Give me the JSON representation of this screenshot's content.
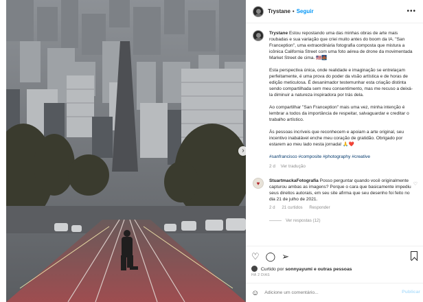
{
  "post": {
    "username": "Trystane",
    "dot": "•",
    "follow_label": "Seguir",
    "more_icon": "more-horizontal-icon"
  },
  "caption": {
    "username": "Trystane",
    "p1": "Estou repostando uma das minhas obras de arte mais roubadas e sua variação que criei muito antes do boom da IA. \"San Franception\", uma extraordinária fotografia composta que mistura a icônica California Street com uma foto aérea de drone da movimentada Market Street de cima. 🇺🇸🌉",
    "p2": "Esta perspectiva única, onde realidade e imaginação se entrelaçam perfeitamente, é uma prova do poder da visão artística e de horas de edição meticulosa. É desanimador testemunhar esta criação distinta sendo compartilhada sem meu consentimento, mas me recuso a deixá-la diminuir a natureza inspiradora por trás dela.",
    "p3": "Ao compartilhar \"San Franception\" mais uma vez, minha intenção é lembrar a todos da importância de respeitar, salvaguardar e creditar o trabalho artístico.",
    "p4": "Às pessoas incríveis que reconhecem e apoiam a arte original, seu incentivo inabalável enche meu coração de gratidão. Obrigado por estarem ao meu lado nesta jornada! 🙏❤️",
    "tags": "#sanfrancisco #composite #photography #creative",
    "age": "2 d",
    "translate": "Ver tradução"
  },
  "comment": {
    "username": "StuartmackaFotografia",
    "text": "Posso perguntar quando você originalmente capturou ambas as imagens? Porque o cara que basicamente impediu seus direitos autorais, em seu site afirma que seu desenho foi feito no dia 21 de julho de 2021.",
    "age": "2 d",
    "likes": "21 curtidos",
    "reply": "Responder",
    "view_replies": "Ver respostas (12)"
  },
  "actions": {
    "liked_prefix": "Curtido por",
    "liked_user": "sonnyayumi",
    "liked_suffix": "e outras pessoas",
    "date": "HÁ 2 DIAS"
  },
  "comment_box": {
    "placeholder": "Adicione um comentário...",
    "publish": "Publicar"
  },
  "colors": {
    "accent": "#0095f6",
    "text": "#262626",
    "muted": "#8e8e8e"
  }
}
